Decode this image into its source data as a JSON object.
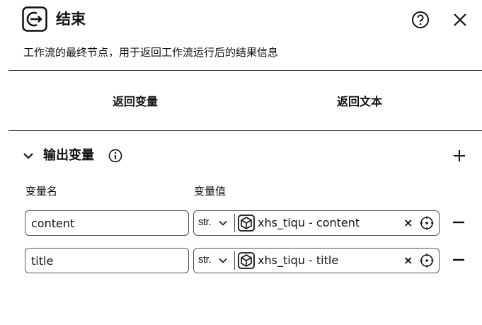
{
  "node": {
    "title": "结束",
    "description": "工作流的最终节点，用于返回工作流运行后的结果信息"
  },
  "icons": {
    "node": "end-node-icon",
    "help": "help-circle-icon",
    "close": "close-icon",
    "chevron": "chevron-down-icon",
    "info": "info-icon",
    "add": "plus-icon",
    "reference": "cube-node-icon",
    "clear": "x-icon",
    "picker": "target-icon",
    "remove": "minus-icon"
  },
  "tabs": [
    {
      "label": "返回变量"
    },
    {
      "label": "返回文本"
    }
  ],
  "output": {
    "section_title": "输出变量",
    "col_name": "变量名",
    "col_value": "变量值",
    "rows": [
      {
        "name": "content",
        "type": "str.",
        "ref": "xhs_tiqu - content",
        "clear": "×"
      },
      {
        "name": "title",
        "type": "str.",
        "ref": "xhs_tiqu - title",
        "clear": "×"
      }
    ]
  },
  "colors": {
    "text": "#111111",
    "border": "#555555",
    "divider": "#333333"
  }
}
